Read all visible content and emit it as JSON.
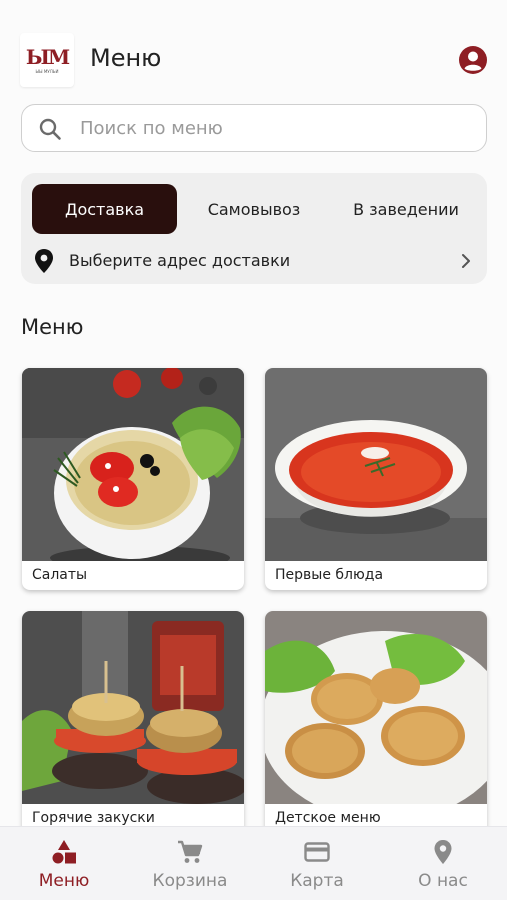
{
  "header": {
    "logo_text": "ЫМ",
    "logo_subtext": "ЫЫ МУЛЬИ",
    "title": "Меню"
  },
  "search": {
    "placeholder": "Поиск по меню",
    "value": ""
  },
  "order_mode": {
    "tabs": [
      {
        "label": "Доставка",
        "active": true
      },
      {
        "label": "Самовывоз",
        "active": false
      },
      {
        "label": "В заведении",
        "active": false
      }
    ],
    "address_prompt": "Выберите адрес доставки"
  },
  "section_title": "Меню",
  "categories": [
    {
      "label": "Салаты",
      "icon": "salad-photo"
    },
    {
      "label": "Первые блюда",
      "icon": "soup-photo"
    },
    {
      "label": "Горячие закуски",
      "icon": "appetizer-photo"
    },
    {
      "label": "Детское меню",
      "icon": "nuggets-photo"
    }
  ],
  "bottom_nav": [
    {
      "label": "Меню",
      "icon": "menu-shapes-icon",
      "active": true
    },
    {
      "label": "Корзина",
      "icon": "cart-icon",
      "active": false
    },
    {
      "label": "Карта",
      "icon": "credit-card-icon",
      "active": false
    },
    {
      "label": "О нас",
      "icon": "location-pin-icon",
      "active": false
    }
  ],
  "colors": {
    "accent": "#8e1e24",
    "active_tab_bg": "#290f0d",
    "page_bg": "#fbfbfb",
    "inactive_nav": "#8a8a8a"
  }
}
